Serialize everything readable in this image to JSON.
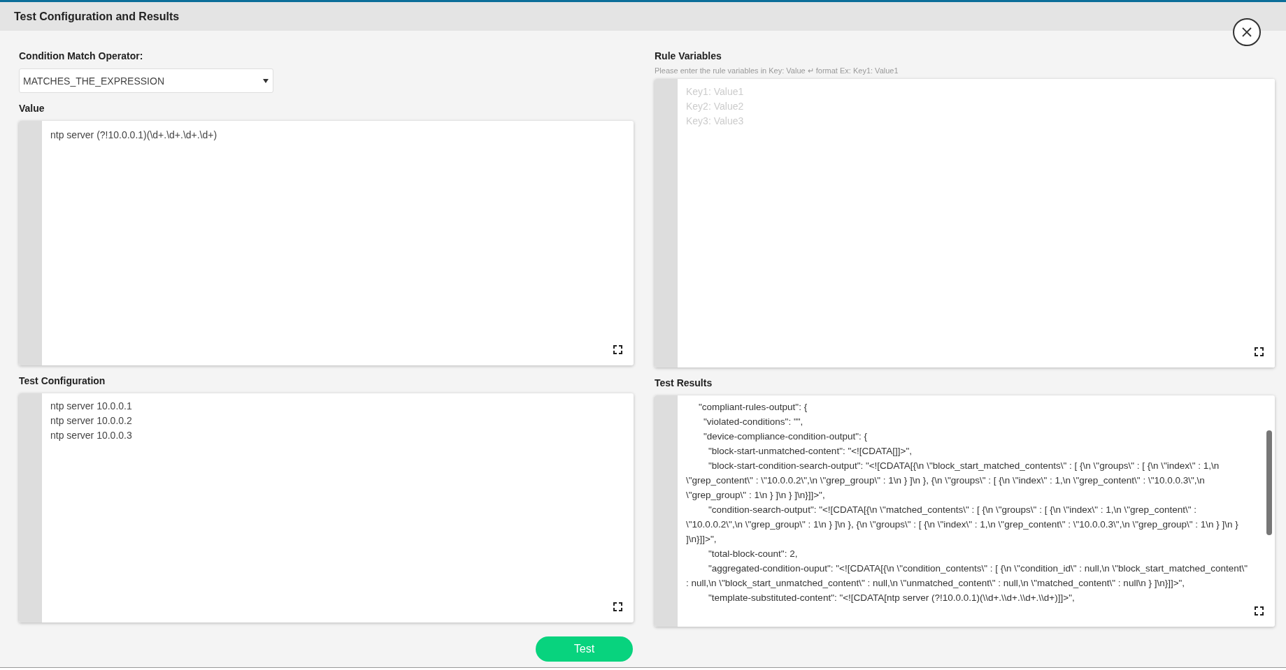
{
  "window": {
    "title": "Test Configuration and Results"
  },
  "condition_operator": {
    "label": "Condition Match Operator:",
    "value": "MATCHES_THE_EXPRESSION"
  },
  "value": {
    "label": "Value",
    "lines": [
      "ntp server (?!10.0.0.1)(\\d+.\\d+.\\d+.\\d+)"
    ]
  },
  "rule_variables": {
    "label": "Rule Variables",
    "hint": "Please enter the rule variables in Key: Value ↵ format Ex: Key1: Value1",
    "placeholder": "Key1: Value1\nKey2: Value2\nKey3: Value3"
  },
  "test_configuration": {
    "label": "Test Configuration",
    "lines": [
      "ntp server 10.0.0.1",
      "ntp server 10.0.0.2",
      "ntp server 10.0.0.3"
    ]
  },
  "test_results": {
    "label": "Test Results",
    "lines": [
      {
        "text": "\"compliant-rules-output\": {",
        "children": [
          {
            "text": "\"violated-conditions\": \"\","
          },
          {
            "text": "\"device-compliance-condition-output\": {",
            "children": [
              {
                "text": "\"block-start-unmatched-content\": \"<![CDATA[]]>\","
              },
              {
                "text": "\"block-start-condition-search-output\": \"<![CDATA[{\\n  \\\"block_start_matched_contents\\\" : [ {\\n    \\\"groups\\\" : [ {\\n      \\\"index\\\" : 1,\\n      \\\"grep_content\\\" : \\\"10.0.0.2\\\",\\n      \\\"grep_group\\\" : 1\\n    } ]\\n  }, {\\n    \\\"groups\\\" : [ {\\n      \\\"index\\\" : 1,\\n      \\\"grep_content\\\" : \\\"10.0.0.3\\\",\\n      \\\"grep_group\\\" : 1\\n    } ]\\n  } ]\\n}]]>\","
              },
              {
                "text": "\"condition-search-output\": \"<![CDATA[{\\n  \\\"matched_contents\\\" : [ {\\n    \\\"groups\\\" : [ {\\n      \\\"index\\\" : 1,\\n      \\\"grep_content\\\" : \\\"10.0.0.2\\\",\\n      \\\"grep_group\\\" : 1\\n    } ]\\n  }, {\\n    \\\"groups\\\" : [ {\\n      \\\"index\\\" : 1,\\n      \\\"grep_content\\\" : \\\"10.0.0.3\\\",\\n      \\\"grep_group\\\" : 1\\n    } ]\\n  } ]\\n}]]>\","
              },
              {
                "text": "\"total-block-count\": 2,"
              },
              {
                "text": "\"aggregated-condition-ouput\": \"<![CDATA[{\\n  \\\"condition_contents\\\" : [ {\\n    \\\"condition_id\\\" : null,\\n    \\\"block_start_matched_content\\\" : null,\\n    \\\"block_start_unmatched_content\\\" : null,\\n    \\\"unmatched_content\\\" : null,\\n    \\\"matched_content\\\" : null\\n  } ]\\n}]]>\","
              },
              {
                "text": "\"template-substituted-content\": \"<![CDATA[ntp server (?!10.0.0.1)(\\\\d+.\\\\d+.\\\\d+.\\\\d+)]]>\","
              }
            ]
          }
        ]
      }
    ]
  },
  "test_button": {
    "label": "Test"
  }
}
